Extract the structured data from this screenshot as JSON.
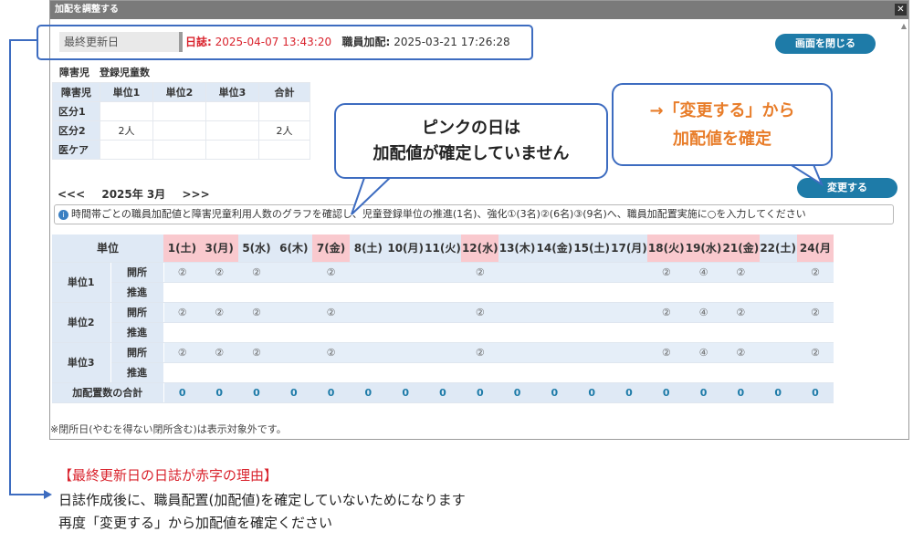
{
  "window": {
    "title": "加配を調整する",
    "close_glyph": "✕"
  },
  "header": {
    "last_update_label": "最終更新日",
    "diary_label": "日誌:",
    "diary_time": "2025-04-07 13:43:20",
    "staff_label": "職員加配:",
    "staff_time": "2025-03-21 17:26:28",
    "close_button": "画面を閉じる"
  },
  "registration": {
    "title": "障害児　登録児童数",
    "columns": [
      "障害児",
      "単位1",
      "単位2",
      "単位3",
      "合計"
    ],
    "rows": [
      [
        "区分1",
        "",
        "",
        "",
        ""
      ],
      [
        "区分2",
        "2人",
        "",
        "",
        "2人"
      ],
      [
        "医ケア",
        "",
        "",
        "",
        ""
      ]
    ]
  },
  "month_nav": {
    "prev": "<<<",
    "label": "2025年 3月",
    "next": ">>>"
  },
  "change_button": "変更する",
  "info_text": "時間帯ごとの職員加配値と障害児童利用人数のグラフを確認し、児童登録単位の推進(1名)、強化①(3名)②(6名)③(9名)へ、職員加配置実施に○を入力してください",
  "grid": {
    "unit_header": "単位",
    "days": [
      {
        "label": "1(土)",
        "pink": true
      },
      {
        "label": "3(月)",
        "pink": true
      },
      {
        "label": "5(水)",
        "pink": false
      },
      {
        "label": "6(木)",
        "pink": false
      },
      {
        "label": "7(金)",
        "pink": true
      },
      {
        "label": "8(土)",
        "pink": false
      },
      {
        "label": "10(月)",
        "pink": false
      },
      {
        "label": "11(火)",
        "pink": false
      },
      {
        "label": "12(水)",
        "pink": true
      },
      {
        "label": "13(木)",
        "pink": false
      },
      {
        "label": "14(金)",
        "pink": false
      },
      {
        "label": "15(土)",
        "pink": false
      },
      {
        "label": "17(月)",
        "pink": false
      },
      {
        "label": "18(火)",
        "pink": true
      },
      {
        "label": "19(水)",
        "pink": true
      },
      {
        "label": "21(金)",
        "pink": true
      },
      {
        "label": "22(土)",
        "pink": false
      },
      {
        "label": "24(月",
        "pink": true
      }
    ],
    "units": [
      {
        "name": "単位1",
        "open": "開所",
        "promote": "推進",
        "open_values": [
          "②",
          "②",
          "②",
          "",
          "②",
          "",
          "",
          "",
          "②",
          "",
          "",
          "",
          "",
          "②",
          "④",
          "②",
          "",
          "②"
        ]
      },
      {
        "name": "単位2",
        "open": "開所",
        "promote": "推進",
        "open_values": [
          "②",
          "②",
          "②",
          "",
          "②",
          "",
          "",
          "",
          "②",
          "",
          "",
          "",
          "",
          "②",
          "④",
          "②",
          "",
          "②"
        ]
      },
      {
        "name": "単位3",
        "open": "開所",
        "promote": "推進",
        "open_values": [
          "②",
          "②",
          "②",
          "",
          "②",
          "",
          "",
          "",
          "②",
          "",
          "",
          "",
          "",
          "②",
          "④",
          "②",
          "",
          "②"
        ]
      }
    ],
    "total_label": "加配置数の合計",
    "totals": [
      "0",
      "0",
      "0",
      "0",
      "0",
      "0",
      "0",
      "0",
      "0",
      "0",
      "0",
      "0",
      "0",
      "0",
      "0",
      "0",
      "0",
      "0"
    ]
  },
  "footnote": "※閉所日(やむを得ない閉所含む)は表示対象外です。",
  "callouts": {
    "pink_line1": "ピンクの日は",
    "pink_line2": "加配値が確定していません",
    "change_line1": "→「変更する」から",
    "change_line2": "加配値を確定"
  },
  "explanation": {
    "title": "【最終更新日の日誌が赤字の理由】",
    "line1": "日誌作成後に、職員配置(加配値)を確定していないためになります",
    "line2": "再度「変更する」から加配値を確定ください"
  },
  "colors": {
    "accent": "#1e7ba8",
    "alert_red": "#d9232d",
    "pink_day": "#f9c9ce",
    "callout_orange": "#e87d2a",
    "bracket_blue": "#3d6cc0"
  }
}
